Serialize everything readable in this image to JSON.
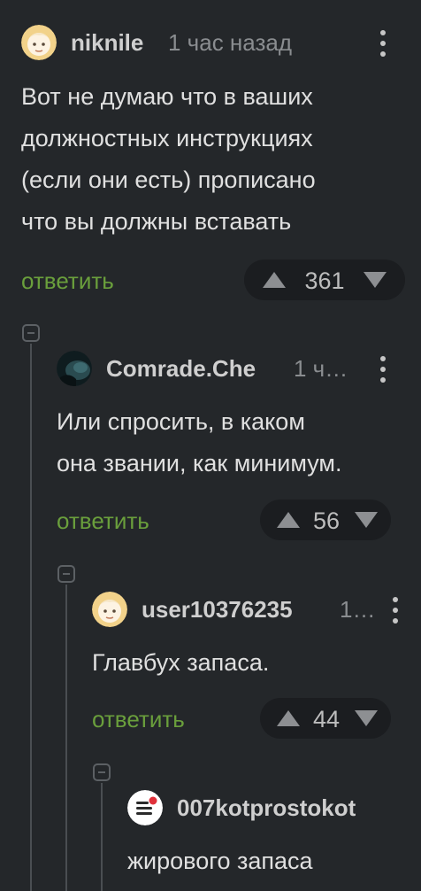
{
  "comments": [
    {
      "username": "niknile",
      "time": "1 час назад",
      "avatar": "cartoon-face-avatar",
      "text_lines": [
        "Вот не думаю что в ваших",
        "должностных инструкциях",
        "(если они есть) прописано",
        "что вы должны вставать"
      ],
      "reply_label": "ответить",
      "rating": "361"
    },
    {
      "username": "Comrade.Che",
      "time": "1 ч…",
      "avatar": "dark-photo-avatar",
      "text_lines": [
        "Или спросить, в каком",
        "она звании, как минимум."
      ],
      "reply_label": "ответить",
      "rating": "56"
    },
    {
      "username": "user10376235",
      "time": "1…",
      "avatar": "cartoon-face-avatar",
      "text_lines": [
        "Главбух запаса."
      ],
      "reply_label": "ответить",
      "rating": "44"
    },
    {
      "username": "007kotprostokot",
      "avatar": "menu-notification-avatar",
      "text_lines": [
        "жирового запаса"
      ]
    }
  ],
  "colors": {
    "background": "#24272a",
    "reply_link": "#6a9f3c",
    "username": "#cfcfcf",
    "timestamp": "#8a8d90",
    "rating_pill": "#1b1d20"
  }
}
